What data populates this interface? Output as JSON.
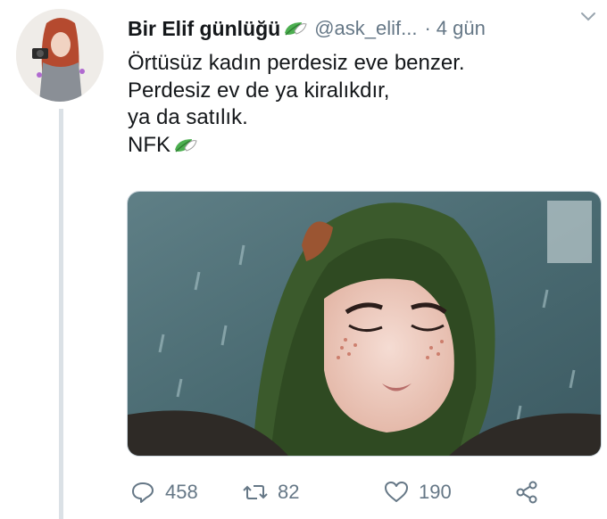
{
  "user": {
    "display_name": "Bir Elif günlüğü",
    "handle": "@ask_elif...",
    "separator": "·",
    "time": "4 gün"
  },
  "tweet": {
    "lines": [
      "Örtüsüz kadın perdesiz eve benzer.",
      "Perdesiz ev de ya kiralıkdır,",
      "ya da satılık.",
      "NFK"
    ]
  },
  "icons": {
    "verified_emoji": "leaf-icon",
    "more": "chevron-down-icon",
    "reply": "reply-icon",
    "retweet": "retweet-icon",
    "like": "heart-icon",
    "share": "share-icon"
  },
  "actions": {
    "replies": "458",
    "retweets": "82",
    "likes": "190"
  },
  "colors": {
    "text": "#14171a",
    "secondary": "#657786",
    "thread_line": "#dbe1e6",
    "leaf_green": "#4caf50"
  }
}
